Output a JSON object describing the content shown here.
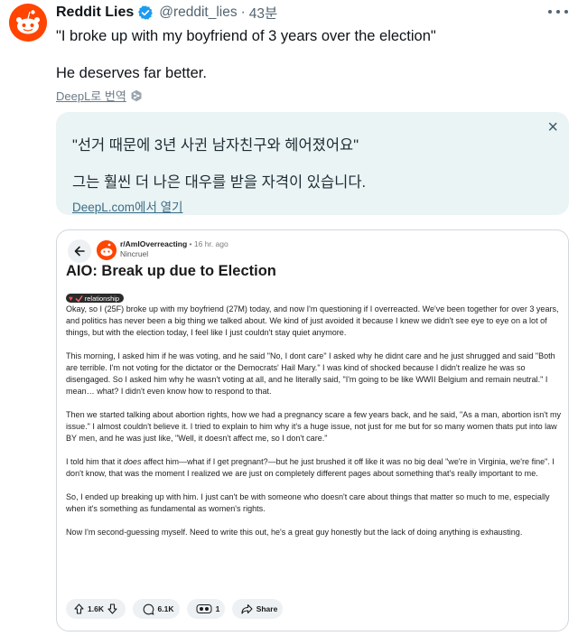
{
  "tweet": {
    "author_name": "Reddit Lies",
    "handle": "@reddit_lies",
    "separator": "·",
    "time": "43분",
    "line1": "\"I broke up with my boyfriend of 3 years over the election\"",
    "line2": "He deserves far better.",
    "translate_label": "DeepL로 번역"
  },
  "translation": {
    "line1": "\"선거 때문에 3년 사귄 남자친구와 헤어졌어요\"",
    "line2": "그는 훨씬 더 나은 대우를 받을 자격이 있습니다.",
    "link": "DeepL.com에서 열기",
    "close": "×"
  },
  "card": {
    "subreddit": "r/AmIOverreacting",
    "time": "• 16 hr. ago",
    "username": "Nincruel",
    "title": "AIO: Break up due to Election",
    "flair": "relationship",
    "paragraphs": [
      "Okay, so I (25F) broke up with my boyfriend (27M) today, and now I'm questioning if I overreacted. We've been together for over 3 years, and politics has never been a big thing we talked about. We kind of just avoided it because I knew we didn't see eye to eye on a lot of things, but with the election today, I feel like I just couldn't stay quiet anymore.",
      "This morning, I asked him if he was voting, and he said \"No, I dont care\" I asked why he didnt care and he just shrugged and said \"Both are terrible. I'm not voting for the dictator or the Democrats' Hail Mary.\" I was kind of shocked because I didn't realize he was so disengaged. So I asked him why he wasn't voting at all, and he literally said, \"I'm going to be like WWII Belgium and remain neutral.\" I mean… what? I didn't even know how to respond to that.",
      "Then we started talking about abortion rights, how we had a pregnancy scare a few years back, and he said, \"As a man, abortion isn't my issue.\" I almost couldn't believe it. I tried to explain to him why it's a huge issue, not just for me but for so many women thats put into law BY men, and he was just like, \"Well, it doesn't affect me, so I don't care.\"",
      "So, I ended up breaking up with him. I just can't be with someone who doesn't care about things that matter so much to me, especially when it's something as fundamental as women's rights.",
      "Now I'm second-guessing myself. Need to write this out, he's a great guy honestly but the lack of doing anything is exhausting."
    ],
    "p4_before": "I told him that it ",
    "p4_em": "does",
    "p4_after": " affect him—what if I get pregnant?—but he just brushed it off like it was no big deal \"we're in Virginia, we're fine\". I don't know, that was the moment I realized we are just on completely different pages about something that's really important to me.",
    "votes": "1.6K",
    "comments": "6.1K",
    "awards": "1",
    "share": "Share"
  },
  "colors": {
    "reddit_orange": "#ff4500",
    "verified_blue": "#1d9bf0",
    "translation_bg": "#eaf4f5"
  }
}
